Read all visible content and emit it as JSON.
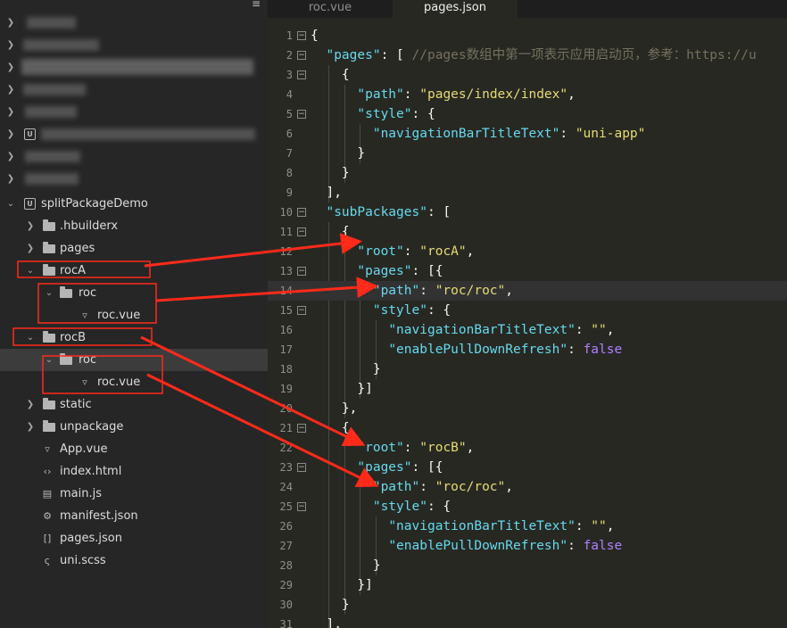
{
  "tabs": [
    {
      "label": "roc.vue",
      "active": false
    },
    {
      "label": "pages.json",
      "active": true
    }
  ],
  "sidebar": {
    "project_name": "splitPackageDemo",
    "tree": [
      {
        "label": ".hbuilderx",
        "type": "folder"
      },
      {
        "label": "pages",
        "type": "folder"
      },
      {
        "label": "rocA",
        "type": "folder"
      },
      {
        "label": "roc",
        "type": "folder"
      },
      {
        "label": "roc.vue",
        "type": "vue"
      },
      {
        "label": "rocB",
        "type": "folder"
      },
      {
        "label": "roc",
        "type": "folder"
      },
      {
        "label": "roc.vue",
        "type": "vue"
      },
      {
        "label": "static",
        "type": "folder"
      },
      {
        "label": "unpackage",
        "type": "folder"
      },
      {
        "label": "App.vue",
        "type": "vue"
      },
      {
        "label": "index.html",
        "type": "html"
      },
      {
        "label": "main.js",
        "type": "js"
      },
      {
        "label": "manifest.json",
        "type": "json"
      },
      {
        "label": "pages.json",
        "type": "json"
      },
      {
        "label": "uni.scss",
        "type": "scss"
      }
    ]
  },
  "code_lines": [
    {
      "n": "1",
      "t": "{"
    },
    {
      "n": "2",
      "t": "  \"pages\": [ //pages数组中第一项表示应用启动页，参考：https://u"
    },
    {
      "n": "3",
      "t": "    {"
    },
    {
      "n": "4",
      "t": "      \"path\": \"pages/index/index\","
    },
    {
      "n": "5",
      "t": "      \"style\": {"
    },
    {
      "n": "6",
      "t": "        \"navigationBarTitleText\": \"uni-app\""
    },
    {
      "n": "7",
      "t": "      }"
    },
    {
      "n": "8",
      "t": "    }"
    },
    {
      "n": "9",
      "t": "  ],"
    },
    {
      "n": "10",
      "t": "  \"subPackages\": ["
    },
    {
      "n": "11",
      "t": "    {"
    },
    {
      "n": "12",
      "t": "      \"root\": \"rocA\","
    },
    {
      "n": "13",
      "t": "      \"pages\": [{"
    },
    {
      "n": "14",
      "t": "        \"path\": \"roc/roc\","
    },
    {
      "n": "15",
      "t": "        \"style\": {"
    },
    {
      "n": "16",
      "t": "          \"navigationBarTitleText\": \"\","
    },
    {
      "n": "17",
      "t": "          \"enablePullDownRefresh\": false"
    },
    {
      "n": "18",
      "t": "        }"
    },
    {
      "n": "19",
      "t": "      }]"
    },
    {
      "n": "20",
      "t": "    },"
    },
    {
      "n": "21",
      "t": "    {"
    },
    {
      "n": "22",
      "t": "      \"root\": \"rocB\","
    },
    {
      "n": "23",
      "t": "      \"pages\": [{"
    },
    {
      "n": "24",
      "t": "        \"path\": \"roc/roc\","
    },
    {
      "n": "25",
      "t": "        \"style\": {"
    },
    {
      "n": "26",
      "t": "          \"navigationBarTitleText\": \"\","
    },
    {
      "n": "27",
      "t": "          \"enablePullDownRefresh\": false"
    },
    {
      "n": "28",
      "t": "        }"
    },
    {
      "n": "29",
      "t": "      }]"
    },
    {
      "n": "30",
      "t": "    }"
    },
    {
      "n": "31",
      "t": "  ],"
    }
  ],
  "current_line": "14",
  "colors": {
    "annotation": "#ff2a1a",
    "string": "#e6db74",
    "key": "#66d9ef",
    "boolean": "#ae81ff"
  }
}
